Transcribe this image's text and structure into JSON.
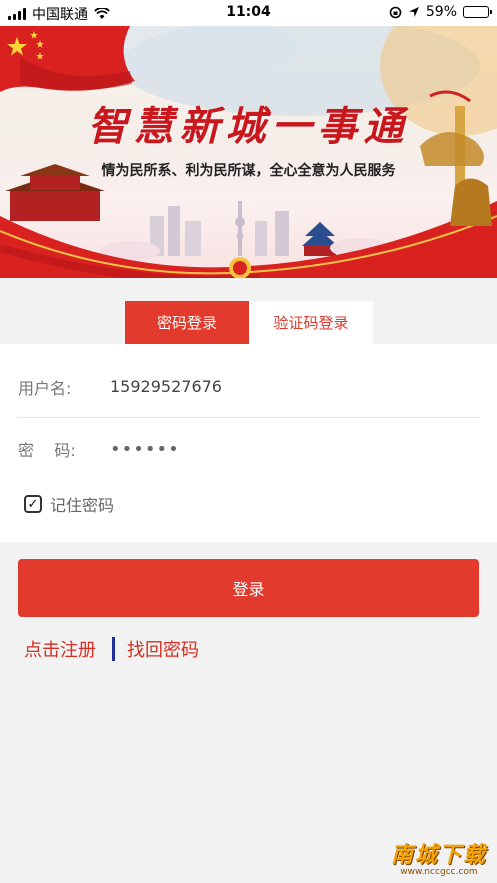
{
  "status_bar": {
    "carrier": "中国联通",
    "time": "11:04",
    "battery": "59%",
    "battery_level": 0.59
  },
  "banner": {
    "title": "智慧新城一事通",
    "subtitle": "情为民所系、利为民所谋，全心全意为人民服务"
  },
  "tabs": [
    {
      "label": "密码登录",
      "active": true
    },
    {
      "label": "验证码登录",
      "active": false
    }
  ],
  "form": {
    "username_label": "用户名:",
    "username_value": "15929527676",
    "password_label": "密    码:",
    "password_value": "••••••",
    "remember_label": "记住密码",
    "remember_checked": true
  },
  "login_button": "登录",
  "links": {
    "register": "点击注册",
    "recover": "找回密码"
  },
  "watermark": {
    "text": "南城下载",
    "url": "www.nccgcc.com"
  },
  "colors": {
    "accent": "#e23a2d",
    "link": "#d32f23",
    "separator": "#1f2f9f",
    "background": "#f2f2f2"
  }
}
